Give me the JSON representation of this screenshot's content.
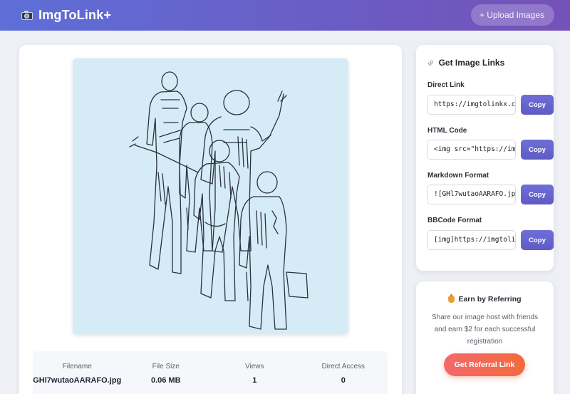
{
  "header": {
    "brand": "ImgToLink+",
    "brand_icon": "camera-icon",
    "upload_label": "+ Upload Images"
  },
  "image": {
    "alt": "GHl7wutaoAARAFO.jpg",
    "background_color": "#d5ecf6"
  },
  "stats": [
    {
      "label": "Filename",
      "value": "GHl7wutaoAARAFO.jpg"
    },
    {
      "label": "File Size",
      "value": "0.06 MB"
    },
    {
      "label": "Views",
      "value": "1"
    },
    {
      "label": "Direct Access",
      "value": "0"
    }
  ],
  "links": {
    "title": "Get Image Links",
    "icon": "link-icon",
    "items": [
      {
        "label": "Direct Link",
        "value": "https://imgtolinkx.c",
        "button": "Copy"
      },
      {
        "label": "HTML Code",
        "value": "<img src=\"https://im",
        "button": "Copy"
      },
      {
        "label": "Markdown Format",
        "value": "![GHl7wutaoAARAFO.jp",
        "button": "Copy"
      },
      {
        "label": "BBCode Format",
        "value": "[img]https://imgtoli",
        "button": "Copy"
      }
    ]
  },
  "referral": {
    "icon": "money-bag-icon",
    "title": "Earn by Referring",
    "description": "Share our image host with friends and earn $2 for each successful registration",
    "button": "Get Referral Link"
  },
  "colors": {
    "header_start": "#5e6fd8",
    "header_end": "#7552b8",
    "copy_button": "#6366d1",
    "referral_button": "#f26a4f"
  }
}
